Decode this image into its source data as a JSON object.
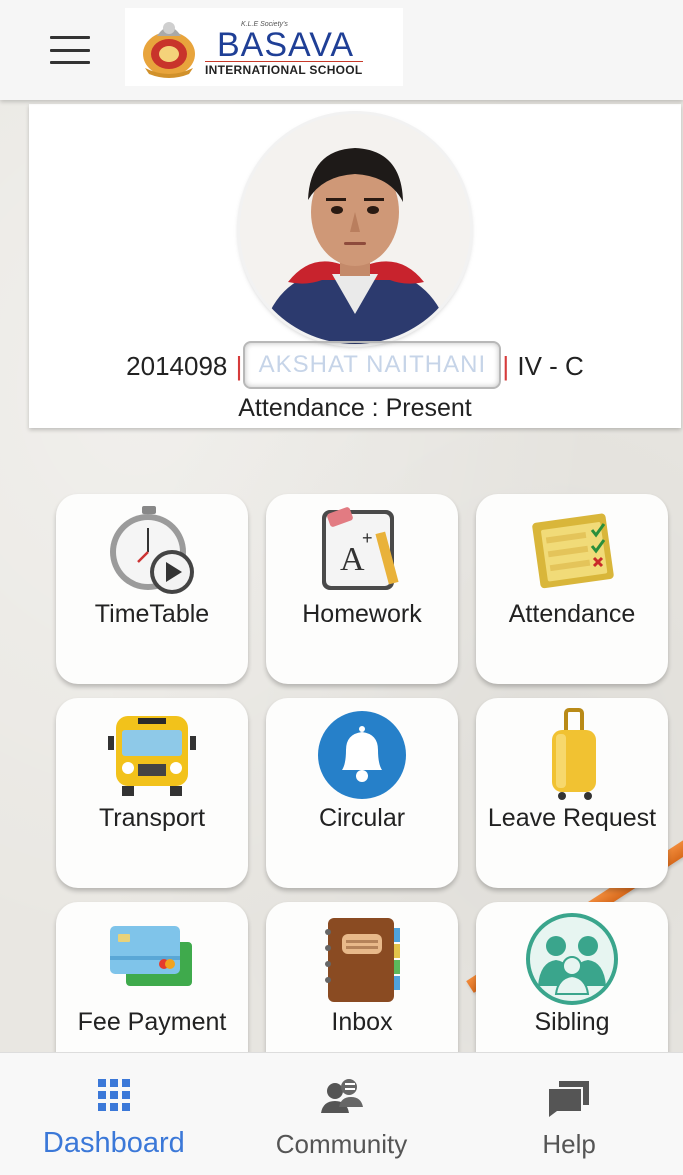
{
  "header": {
    "logo_small": "K.L.E Society's",
    "logo_name": "BASAVA",
    "logo_sub": "INTERNATIONAL SCHOOL"
  },
  "profile": {
    "student_id": "2014098",
    "student_name": "AKSHAT NAITHANI",
    "class": "IV - C",
    "attendance": "Attendance : Present"
  },
  "tiles": [
    {
      "label": "TimeTable",
      "icon": "stopwatch-play-icon"
    },
    {
      "label": "Homework",
      "icon": "homework-pencil-icon"
    },
    {
      "label": "Attendance",
      "icon": "checklist-icon"
    },
    {
      "label": "Transport",
      "icon": "school-bus-icon"
    },
    {
      "label": "Circular",
      "icon": "bell-icon"
    },
    {
      "label": "Leave Request",
      "icon": "suitcase-icon"
    },
    {
      "label": "Fee Payment",
      "icon": "credit-cards-icon"
    },
    {
      "label": "Inbox",
      "icon": "notebook-icon"
    },
    {
      "label": "Sibling",
      "icon": "family-icon"
    }
  ],
  "bottom_nav": [
    {
      "label": "Dashboard",
      "icon": "grid-icon",
      "active": true
    },
    {
      "label": "Community",
      "icon": "people-chat-icon",
      "active": false
    },
    {
      "label": "Help",
      "icon": "chat-bubbles-icon",
      "active": false
    }
  ],
  "colors": {
    "accent": "#3b78d8",
    "separator": "#d63b3b",
    "logo_blue": "#1f3f96"
  }
}
